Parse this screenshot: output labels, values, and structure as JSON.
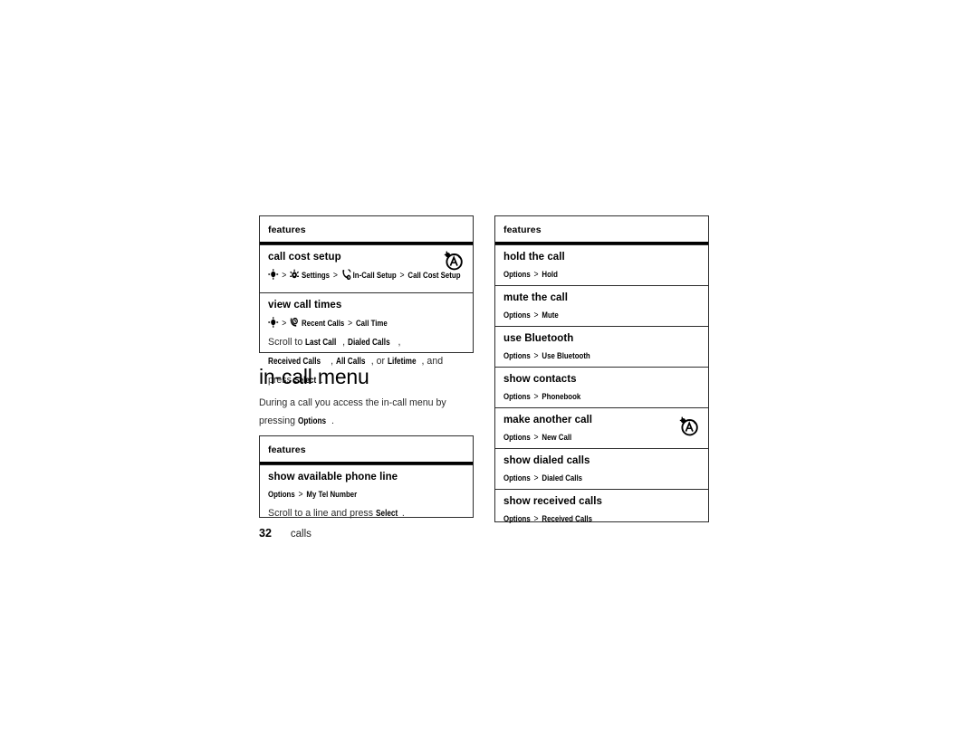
{
  "page": {
    "number": "32",
    "section_label": "calls"
  },
  "heading": {
    "title": "in-call menu",
    "intro_before": "During a call you access the in-call menu by pressing ",
    "intro_keyword": "Options",
    "intro_after": "."
  },
  "tables": {
    "call_settings": {
      "header": "features",
      "rows": [
        {
          "title": "call cost setup",
          "path_icons": [
            "navigation-key-icon",
            "settings-icon",
            "in-call-setup-icon"
          ],
          "path_text": "> Settings > In-Call Setup > Call Cost Setup",
          "path_parts": [
            "Settings",
            "In-Call Setup",
            "Call Cost Setup"
          ],
          "badge": "network-dependent-icon"
        },
        {
          "title": "view call times",
          "path_icons": [
            "navigation-key-icon",
            "recent-calls-icon"
          ],
          "path_text": "> Recent Calls > Call Time",
          "path_parts": [
            "Recent Calls",
            "Call Time"
          ],
          "note_before": "Scroll to ",
          "note_keywords": [
            "Last Call",
            "Dialed Calls",
            "Received Calls",
            "All Calls"
          ],
          "note_mid": ", or ",
          "note_keyword_last": "Lifetime",
          "note_after": ", and press ",
          "note_keyword_end": "Select",
          "note_end": "."
        }
      ]
    },
    "in_call_left": {
      "header": "features",
      "rows": [
        {
          "title": "show available phone line",
          "path_text": "Options > My Tel Number",
          "path_parts": [
            "Options",
            "My Tel Number"
          ],
          "note_before": "Scroll to a line and press ",
          "note_keyword_end": "Select",
          "note_end": "."
        }
      ]
    },
    "in_call_right": {
      "header": "features",
      "rows": [
        {
          "title": "hold the call",
          "path_parts": [
            "Options",
            "Hold"
          ]
        },
        {
          "title": "mute the call",
          "path_parts": [
            "Options",
            "Mute"
          ]
        },
        {
          "title": "use Bluetooth",
          "path_parts": [
            "Options",
            "Use Bluetooth"
          ]
        },
        {
          "title": "show contacts",
          "path_parts": [
            "Options",
            "Phonebook"
          ]
        },
        {
          "title": "make another call",
          "path_parts": [
            "Options",
            "New Call"
          ],
          "badge": "network-dependent-icon"
        },
        {
          "title": "show dialed calls",
          "path_parts": [
            "Options",
            "Dialed Calls"
          ]
        },
        {
          "title": "show received calls",
          "path_parts": [
            "Options",
            "Received Calls"
          ]
        }
      ]
    }
  },
  "colors": {
    "text": "#000000",
    "body_text": "#2a2a2a",
    "rule": "#2b2b2b",
    "background": "#ffffff"
  }
}
